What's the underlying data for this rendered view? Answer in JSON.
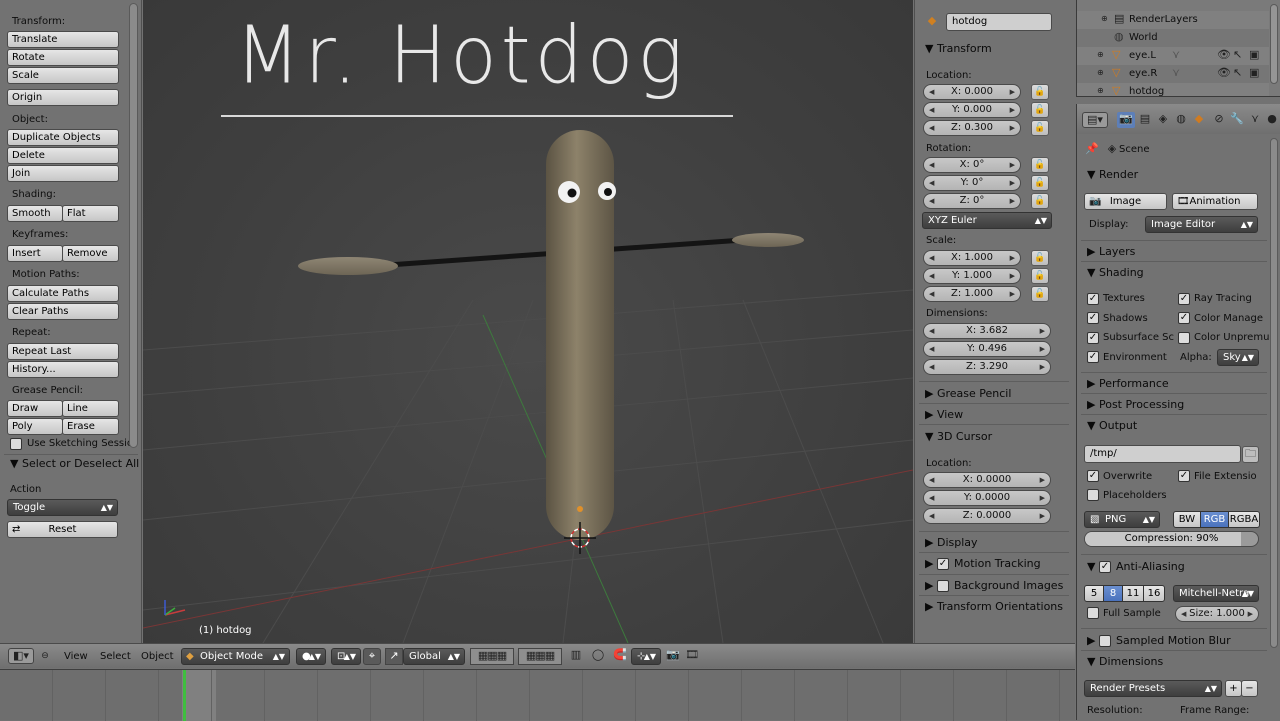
{
  "toolshelf": {
    "transform_header": "Transform:",
    "translate": "Translate",
    "rotate": "Rotate",
    "scale": "Scale",
    "origin": "Origin",
    "object_header": "Object:",
    "duplicate_objects": "Duplicate Objects",
    "delete": "Delete",
    "join": "Join",
    "shading_header": "Shading:",
    "smooth": "Smooth",
    "flat": "Flat",
    "keyframes_header": "Keyframes:",
    "insert": "Insert",
    "remove": "Remove",
    "motion_paths_header": "Motion Paths:",
    "calculate_paths": "Calculate Paths",
    "clear_paths": "Clear Paths",
    "repeat_header": "Repeat:",
    "repeat_last": "Repeat Last",
    "history": "History...",
    "grease_pencil_header": "Grease Pencil:",
    "draw": "Draw",
    "line": "Line",
    "poly": "Poly",
    "erase": "Erase",
    "use_sketching": "Use Sketching Sessio",
    "operator_title": "Select or Deselect All",
    "action_label": "Action",
    "action_value": "Toggle",
    "reset": "Reset"
  },
  "viewport": {
    "annotation": "Mr. Hotdog",
    "object_label": "(1) hotdog"
  },
  "npanel": {
    "object_name": "hotdog",
    "transform_header": "Transform",
    "location_label": "Location:",
    "loc_x": "X: 0.000",
    "loc_y": "Y: 0.000",
    "loc_z": "Z: 0.300",
    "rotation_label": "Rotation:",
    "rot_x": "X: 0°",
    "rot_y": "Y: 0°",
    "rot_z": "Z: 0°",
    "rotation_mode": "XYZ Euler",
    "scale_label": "Scale:",
    "scl_x": "X: 1.000",
    "scl_y": "Y: 1.000",
    "scl_z": "Z: 1.000",
    "dimensions_label": "Dimensions:",
    "dim_x": "X: 3.682",
    "dim_y": "Y: 0.496",
    "dim_z": "Z: 3.290",
    "grease_pencil": "Grease Pencil",
    "view": "View",
    "cursor_header": "3D Cursor",
    "cursor_location_label": "Location:",
    "cur_x": "X: 0.0000",
    "cur_y": "Y: 0.0000",
    "cur_z": "Z: 0.0000",
    "display": "Display",
    "motion_tracking": "Motion Tracking",
    "background_images": "Background Images",
    "transform_orientations": "Transform Orientations"
  },
  "outliner": {
    "items": [
      {
        "label": "RenderLayers"
      },
      {
        "label": "World"
      },
      {
        "label": "eye.L"
      },
      {
        "label": "eye.R"
      },
      {
        "label": "hotdog"
      }
    ]
  },
  "properties": {
    "scene": "Scene",
    "render_header": "Render",
    "image_btn": "Image",
    "animation_btn": "Animation",
    "display_label": "Display:",
    "display_value": "Image Editor",
    "layers": "Layers",
    "shading": "Shading",
    "textures": "Textures",
    "ray_tracing": "Ray Tracing",
    "shadows": "Shadows",
    "color_manage": "Color Manage",
    "subsurface": "Subsurface Sc",
    "color_unpremul": "Color Unpremu",
    "environment": "Environment",
    "alpha_label": "Alpha:",
    "alpha_value": "Sky",
    "performance": "Performance",
    "post_processing": "Post Processing",
    "output": "Output",
    "output_path": "/tmp/",
    "overwrite": "Overwrite",
    "file_extensions": "File Extensio",
    "placeholders": "Placeholders",
    "format": "PNG",
    "bw": "BW",
    "rgb": "RGB",
    "rgba": "RGBA",
    "compression": "Compression: 90%",
    "compression_level": 0.9,
    "anti_aliasing": "Anti-Aliasing",
    "aa_5": "5",
    "aa_8": "8",
    "aa_11": "11",
    "aa_16": "16",
    "filter": "Mitchell-Netra",
    "full_sample": "Full Sample",
    "size": "Size: 1.000",
    "sampled_motion_blur": "Sampled Motion Blur",
    "dimensions": "Dimensions",
    "render_presets": "Render Presets",
    "resolution": "Resolution:",
    "frame_range": "Frame Range:"
  },
  "header3d": {
    "view": "View",
    "select": "Select",
    "object": "Object",
    "mode": "Object Mode",
    "orientation": "Global"
  }
}
